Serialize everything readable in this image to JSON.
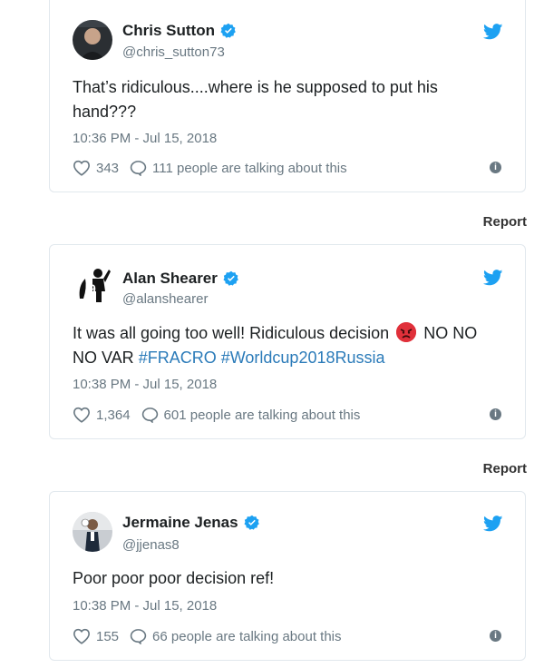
{
  "colors": {
    "accent": "#1da1f2",
    "link": "#2b7bb9",
    "muted": "#697882",
    "text": "#1c2022"
  },
  "tweets": [
    {
      "name": "Chris Sutton",
      "handle": "@chris_sutton73",
      "text_line1": "That’s ridiculous....where is he supposed to put his",
      "text_line2": "hand???",
      "timestamp": "10:36 PM - Jul 15, 2018",
      "likes": "343",
      "talking": "111 people are talking about this"
    },
    {
      "name": "Alan Shearer",
      "handle": "@alanshearer",
      "text_line1_a": "It was all going too well! Ridiculous decision",
      "text_line1_b": "NO NO",
      "text_line2_a": "NO VAR",
      "hashtag1": "#FRACRO",
      "hashtag2": "#Worldcup2018Russia",
      "emoji": "angry-face",
      "timestamp": "10:38 PM - Jul 15, 2018",
      "likes": "1,364",
      "talking": "601 people are talking about this"
    },
    {
      "name": "Jermaine Jenas",
      "handle": "@jjenas8",
      "text_line1": "Poor poor poor decision ref!",
      "timestamp": "10:38 PM - Jul 15, 2018",
      "likes": "155",
      "talking": "66 people are talking about this"
    }
  ],
  "report_label": "Report",
  "info_glyph": "i"
}
